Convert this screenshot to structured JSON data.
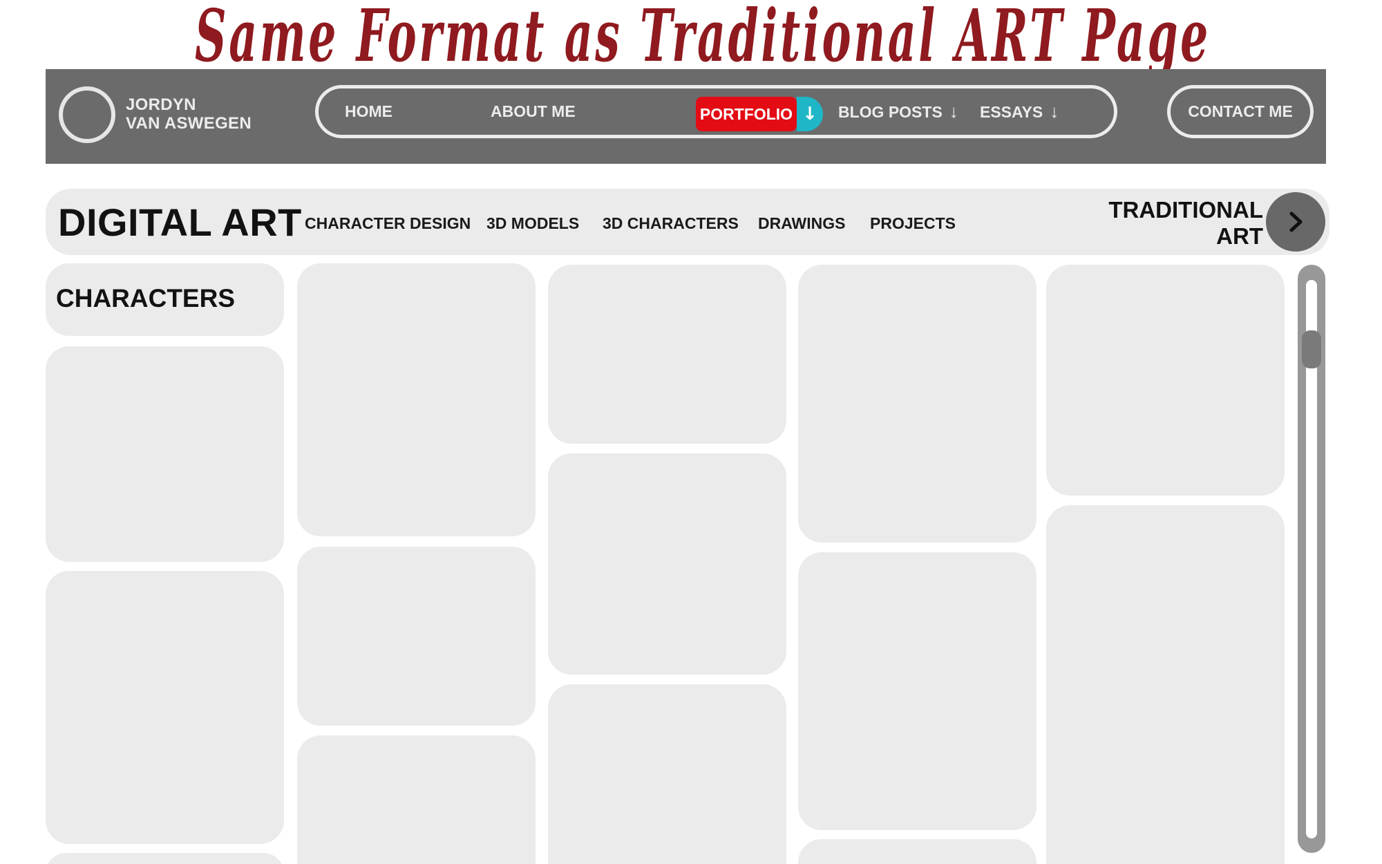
{
  "annotation": {
    "text": "Same Format as Traditional ART Page",
    "color": "#8f1a1f"
  },
  "header": {
    "brand_line1": "JORDYN",
    "brand_line2": "VAN ASWEGEN",
    "avatar_icon": "avatar-circle-icon",
    "nav": {
      "home": "HOME",
      "about": "ABOUT ME",
      "portfolio": "PORTFOLIO",
      "portfolio_arrow": "↓",
      "blog": "BLOG POSTS",
      "blog_arrow": "↓",
      "essays": "ESSAYS",
      "essays_arrow": "↓"
    },
    "contact": "CONTACT ME",
    "colors": {
      "bar": "#6b6b6b",
      "portfolio_active": "#e30b14",
      "portfolio_arrow": "#1fb7c8"
    }
  },
  "subheader": {
    "title": "DIGITAL ART",
    "tabs": [
      "CHARACTER DESIGN",
      "3D MODELS",
      "3D CHARACTERS",
      "DRAWINGS",
      "PROJECTS"
    ],
    "next_label_line1": "TRADITIONAL",
    "next_label_line2": "ART",
    "next_icon": "chevron-right-icon"
  },
  "content": {
    "category_title": "CHARACTERS",
    "tile_color": "#ebebeb"
  }
}
